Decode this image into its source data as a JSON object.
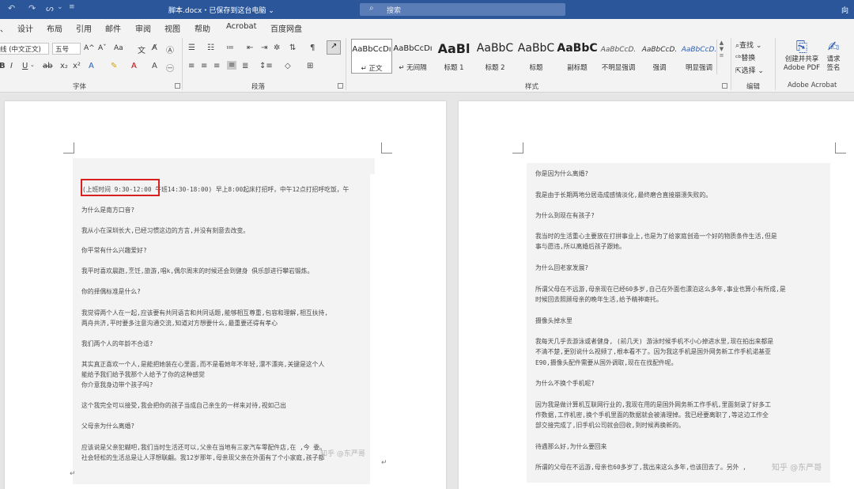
{
  "titlebar": {
    "undo_icon": "undo-icon",
    "redo_icon": "redo-icon",
    "doc_title": "脚本.docx・已保存到这台电脑 ⌄",
    "search_placeholder": "搜索",
    "account": "向"
  },
  "tabs": [
    {
      "label": "设计"
    },
    {
      "label": "布局"
    },
    {
      "label": "引用"
    },
    {
      "label": "邮件"
    },
    {
      "label": "审阅"
    },
    {
      "label": "视图"
    },
    {
      "label": "帮助"
    },
    {
      "label": "Acrobat"
    },
    {
      "label": "百度网盘"
    }
  ],
  "ribbon": {
    "font": {
      "name": "线 (中文正文)",
      "size": "五号",
      "grow": "A^",
      "shrink": "Aˇ",
      "case": "Aa",
      "group_label": "字体"
    },
    "paragraph": {
      "group_label": "段落"
    },
    "styles": {
      "group_label": "样式",
      "items": [
        {
          "sample": "AaBbCcDı",
          "name": "↵ 正文"
        },
        {
          "sample": "AaBbCcDı",
          "name": "↵ 无间隔"
        },
        {
          "sample": "AaBl",
          "name": "标题 1"
        },
        {
          "sample": "AaBbC",
          "name": "标题 2"
        },
        {
          "sample": "AaBbC",
          "name": "标题"
        },
        {
          "sample": "AaBbC",
          "name": "副标题"
        },
        {
          "sample": "AaBbCcD.",
          "name": "不明显强调"
        },
        {
          "sample": "AaBbCcD.",
          "name": "强调"
        },
        {
          "sample": "AaBbCcD.",
          "name": "明显强调"
        }
      ]
    },
    "editing": {
      "find": "查找",
      "replace": "替换",
      "select": "选择",
      "group_label": "编辑"
    },
    "acrobat": {
      "create_share": "创建并共享",
      "create_share_2": "Adobe PDF",
      "request": "请求",
      "request_2": "签名",
      "group_label": "Adobe Acrobat"
    }
  },
  "left_page": {
    "lines": [
      "(上班时间 9:30-12:00 午班14:30-18:00) 早上8:00起床打招呼，中午12点打招呼吃饭，午",
      "为什么是南方口音?",
      "我从小在深圳长大,已经习惯这边的方言,并没有刻意去改变。",
      "你平常有什么兴趣爱好?",
      "我平时喜欢晨跑,烹饪,旅游,唱k,偶尔周末的时候还会到健身 俱乐部进行攀岩锻炼。",
      "你的择偶标准是什么?",
      "我觉得两个人在一起,应该要有共同语言和共同话题,能够相互尊重,包容和理解,相互扶持,",
      "两舟共济,平时要多注意沟通交流,知道对方想要什么,最重要还得有孝心",
      "我们两个人的年龄不合适?",
      "其实真正喜欢一个人,是能把她装在心里面,而不是看她年不年轻,漂不漂亮,关键是这个人",
      "能给予我们给予我那个人给予了你的这种感觉",
      "你介意我身边带个孩子吗?",
      "这个我完全可以接受,我会把你的孩子当成自己亲生的一样来对待,视如己出",
      "父母亲为什么离婚?",
      "应该说是父亲犯糊吧,我们当时生活还可以,父亲在当地有三家汽车零配件店,在 ,今 委。",
      "社会轻松的生活总是让人浮想联翩。我12岁那年,母亲现父亲在外面有了个小家庭,孩子都"
    ]
  },
  "right_page": {
    "lines": [
      "你是因为什么离婚?",
      "我是由于长期两地分居造成感情淡化,最终磨合直接崩溃失败的。",
      "为什么到现在有孩子?",
      "我当时的生活重心主要放在打拼事业上,也是为了给家庭创造一个好的物质条件生活,但是",
      "事与愿违,所以离婚后孩子跟她。",
      "为什么回老家发展?",
      "所谓父母在不远游,母亲现在已经60多岁,自己在外面也漂泊这么多年,事业也算小有所成,是",
      "时候回去照顾母亲的晚年生活,给予精神寄托。",
      "摄像头掉水里",
      "我每天几乎去游泳或者健身, (前几天) 游泳时候手机不小心掉进水里,现在拍出来都是",
      "不清不楚,更别说什么视频了,根本看不了。因为我这手机是国外网务新工作手机诺基亚",
      "E90,摄像头配件需要从国外调取,现在在找配件呢。",
      "为什么不换个手机呢?",
      "因为我是做计算机互联网行业的,我现在用的是国外网务新工作手机,里面刻录了好多工",
      "作数据,工作机密,换个手机里面的数据就会被清理掉。我已经要离职了,等这边工作全",
      "部交接完成了,旧手机公司就会回收,到时候再换新的。",
      "待遇那么好,为什么要回来",
      "所谓的父母在不远游,母亲也60多岁了,我出来这么多年,也该回去了。另外 ,"
    ]
  },
  "watermarks": [
    "知乎 @东严哥",
    "知乎 @东严哥"
  ]
}
